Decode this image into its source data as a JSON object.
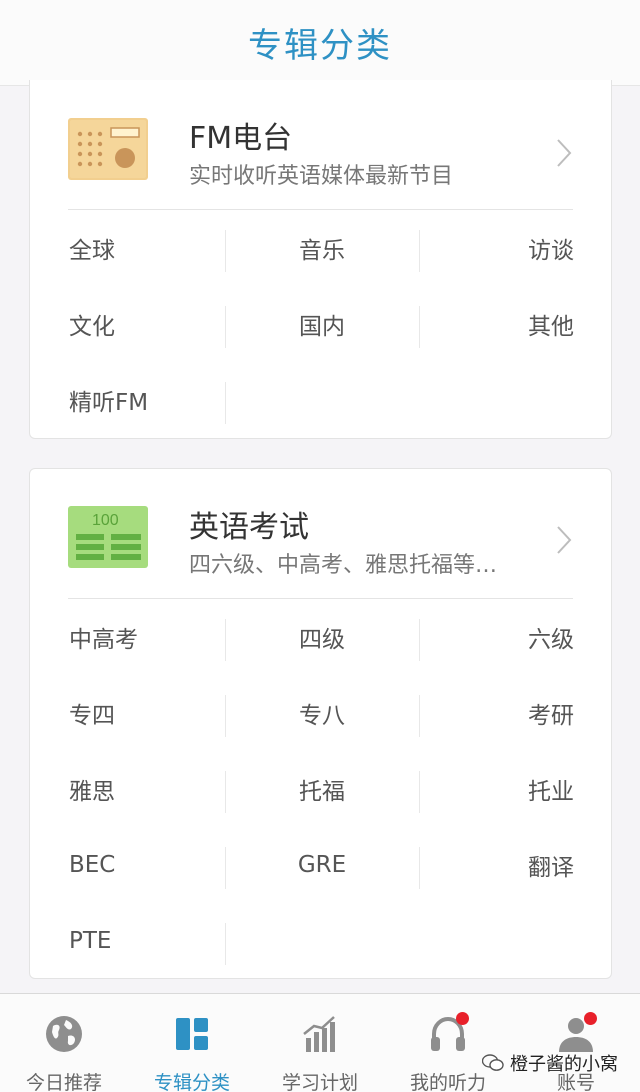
{
  "header": {
    "title": "专辑分类"
  },
  "cards": {
    "fm": {
      "title": "FM电台",
      "subtitle": "实时收听英语媒体最新节目",
      "rows": [
        [
          "全球",
          "音乐",
          "访谈"
        ],
        [
          "文化",
          "国内",
          "其他"
        ],
        [
          "精听FM",
          "",
          ""
        ]
      ]
    },
    "exam": {
      "title": "英语考试",
      "subtitle": "四六级、中高考、雅思托福等…",
      "icon_text": "100",
      "rows": [
        [
          "中高考",
          "四级",
          "六级"
        ],
        [
          "专四",
          "专八",
          "考研"
        ],
        [
          "雅思",
          "托福",
          "托业"
        ],
        [
          "BEC",
          "GRE",
          "翻译"
        ],
        [
          "PTE",
          "",
          ""
        ]
      ]
    }
  },
  "tabbar": {
    "tabs": [
      {
        "label": "今日推荐",
        "icon": "globe-icon"
      },
      {
        "label": "专辑分类",
        "icon": "category-grid-icon"
      },
      {
        "label": "学习计划",
        "icon": "bar-chart-icon"
      },
      {
        "label": "我的听力",
        "icon": "headphones-icon"
      },
      {
        "label": "账号",
        "icon": "user-icon"
      }
    ],
    "active_color": "#2e91c4",
    "badge_color": "#e8202a"
  },
  "watermark": {
    "text": "橙子酱的小窝"
  }
}
